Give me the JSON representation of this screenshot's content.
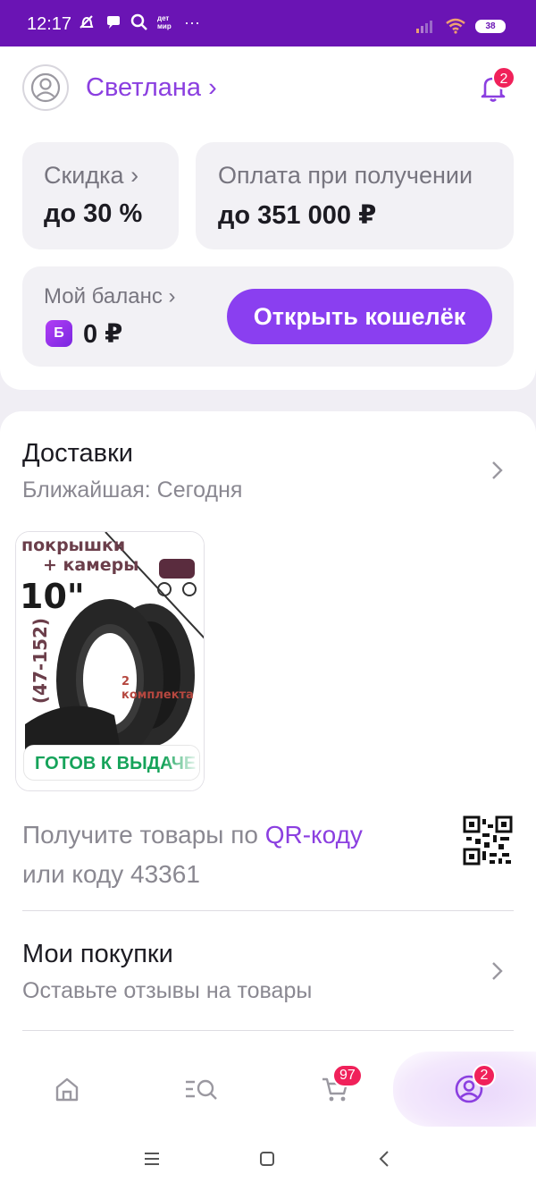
{
  "status_bar": {
    "time": "12:17",
    "battery": "38",
    "extra": "···",
    "app_badge": "дет мир"
  },
  "header": {
    "user_name": "Светлана ›",
    "notifications_count": "2"
  },
  "tiles": {
    "discount": {
      "label": "Скидка ›",
      "value": "до 30 %"
    },
    "payment": {
      "label": "Оплата при получении",
      "value": "до 351 000 ₽"
    },
    "balance": {
      "label": "Мой баланс ›",
      "currency_icon": "Б",
      "value": "0 ₽",
      "button": "Открыть кошелёк"
    }
  },
  "deliveries": {
    "title": "Доставки",
    "subtitle": "Ближайшая: Сегодня",
    "product": {
      "image_text": {
        "line1": "покрышки",
        "line2": "+ камеры",
        "size": "10\"",
        "range": "(47-152)",
        "sets": "2 комплекта"
      },
      "status": "ГОТОВ К ВЫДАЧЕ"
    },
    "qr_text_before": "Получите товары по ",
    "qr_link": "QR-коду",
    "qr_text_after": "или коду 43361"
  },
  "purchases": {
    "title": "Мои покупки",
    "subtitle": "Оставьте отзывы на товары"
  },
  "bottom_nav": {
    "items": [
      {
        "name": "home-icon"
      },
      {
        "name": "catalog-search-icon"
      },
      {
        "name": "cart-icon",
        "badge": "97"
      },
      {
        "name": "profile-icon",
        "badge": "2",
        "active": true
      }
    ]
  },
  "colors": {
    "status_bar": "#6a14b4",
    "accent": "#8a3ff0",
    "badge": "#f0215a",
    "success": "#16a35a"
  }
}
